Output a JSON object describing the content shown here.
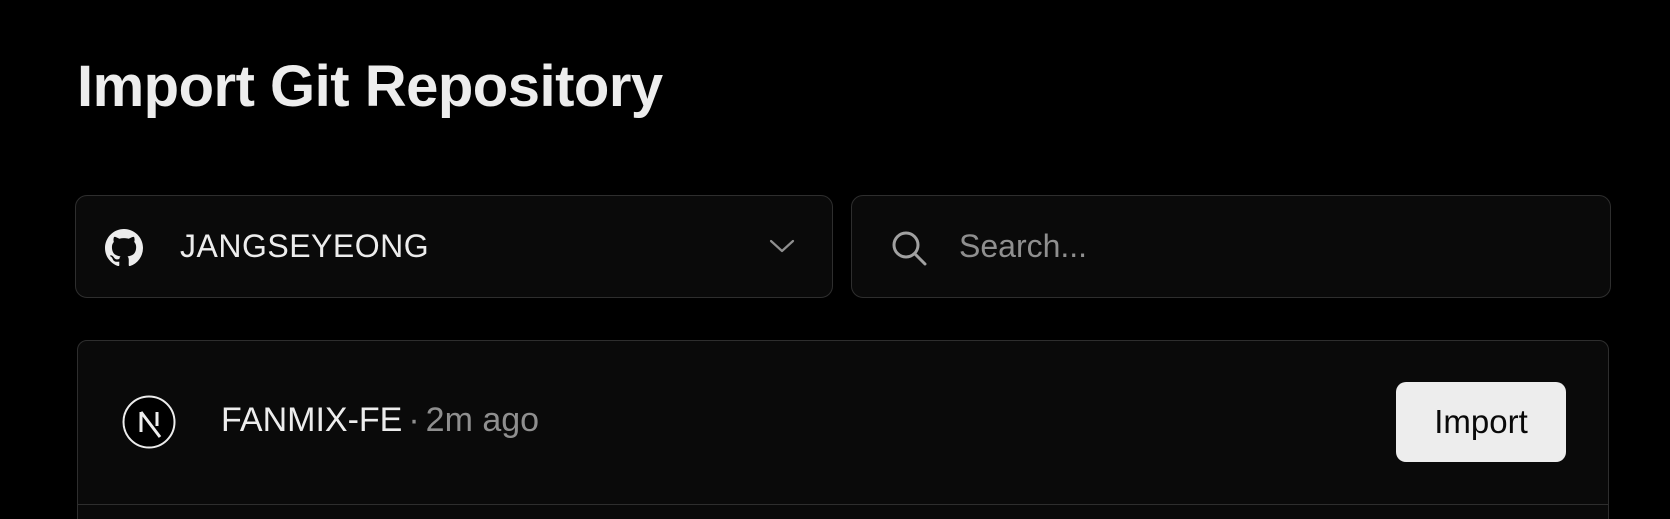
{
  "page": {
    "title": "Import Git Repository"
  },
  "account_select": {
    "provider_icon": "github-icon",
    "selected_account": "JANGSEYEONG",
    "dropdown_icon": "chevron-down-icon"
  },
  "search": {
    "icon": "search-icon",
    "placeholder": "Search...",
    "value": ""
  },
  "repositories": [
    {
      "logo_icon": "nextjs-logo-icon",
      "name": "FANMIX-FE",
      "separator": "·",
      "updated": "2m ago",
      "action_label": "Import"
    }
  ],
  "colors": {
    "background": "#000000",
    "surface": "#0a0a0a",
    "border": "#2e2e2e",
    "text_primary": "#ededed",
    "text_muted": "#8f8f8f",
    "button_bg": "#ededed",
    "button_text": "#0a0a0a"
  }
}
